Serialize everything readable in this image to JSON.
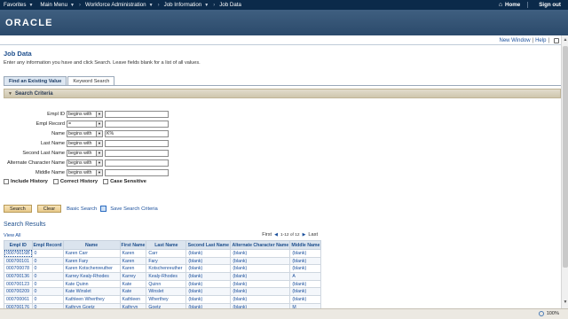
{
  "nav": {
    "items": [
      "Favorites",
      "Main Menu",
      "Workforce Administration",
      "Job Information",
      "Job Data"
    ],
    "home": "Home",
    "signout": "Sign out"
  },
  "brand": {
    "logo": "ORACLE"
  },
  "util": {
    "new_window": "New Window",
    "help": "Help"
  },
  "page": {
    "title": "Job Data",
    "instructions": "Enter any information you have and click Search. Leave fields blank for a list of all values."
  },
  "tabs": [
    "Find an Existing Value",
    "Keyword Search"
  ],
  "section": {
    "title": "Search Criteria"
  },
  "form": {
    "fields": [
      {
        "label": "Empl ID",
        "operator": "begins with",
        "value": ""
      },
      {
        "label": "Empl Record",
        "operator": "=",
        "value": ""
      },
      {
        "label": "Name",
        "operator": "begins with",
        "value": "K%"
      },
      {
        "label": "Last Name",
        "operator": "begins with",
        "value": ""
      },
      {
        "label": "Second Last Name",
        "operator": "begins with",
        "value": ""
      },
      {
        "label": "Alternate Character Name",
        "operator": "begins with",
        "value": ""
      },
      {
        "label": "Middle Name",
        "operator": "begins with",
        "value": ""
      }
    ],
    "checkboxes": [
      "Include History",
      "Correct History",
      "Case Sensitive"
    ]
  },
  "actions": {
    "search": "Search",
    "clear": "Clear",
    "basic_search": "Basic Search",
    "save_criteria": "Save Search Criteria"
  },
  "results": {
    "title": "Search Results",
    "view_all": "View All",
    "first": "First",
    "count": "1-12 of 12",
    "last": "Last",
    "columns": [
      "Empl ID",
      "Empl Record",
      "Name",
      "First Name",
      "Last Name",
      "Second Last Name",
      "Alternate Character Name",
      "Middle Name"
    ],
    "rows": [
      [
        "00070016B",
        "0",
        "Karen Carr",
        "Karen",
        "Carr",
        "(blank)",
        "(blank)",
        "(blank)"
      ],
      [
        "000700101",
        "0",
        "Karen Fary",
        "Karen",
        "Fary",
        "(blank)",
        "(blank)",
        "(blank)"
      ],
      [
        "000700078",
        "0",
        "Karen Kotschenreuther",
        "Karen",
        "Kotschenreuther",
        "(blank)",
        "(blank)",
        "(blank)"
      ],
      [
        "000700136",
        "0",
        "Karrey Kealy-Rhodes",
        "Karrey",
        "Kealy-Rhodes",
        "(blank)",
        "(blank)",
        "A"
      ],
      [
        "000700123",
        "0",
        "Kate Quinn",
        "Kate",
        "Quinn",
        "(blank)",
        "(blank)",
        "(blank)"
      ],
      [
        "000700209",
        "0",
        "Kate Winslet",
        "Kate",
        "Winslet",
        "(blank)",
        "(blank)",
        "(blank)"
      ],
      [
        "000700061",
        "0",
        "Kathleen Wherthey",
        "Kathleen",
        "Wherthey",
        "(blank)",
        "(blank)",
        "(blank)"
      ],
      [
        "000700176",
        "0",
        "Kathryn Goetz",
        "Kathryn",
        "Goetz",
        "(blank)",
        "(blank)",
        "M"
      ]
    ]
  },
  "status": {
    "zoom": "100%"
  },
  "colors": {
    "nav_bg": "#0b2a4a",
    "brand_bg": "#2b4a6b",
    "link": "#1a4f9c",
    "section_bg": "#cfc6ad"
  }
}
